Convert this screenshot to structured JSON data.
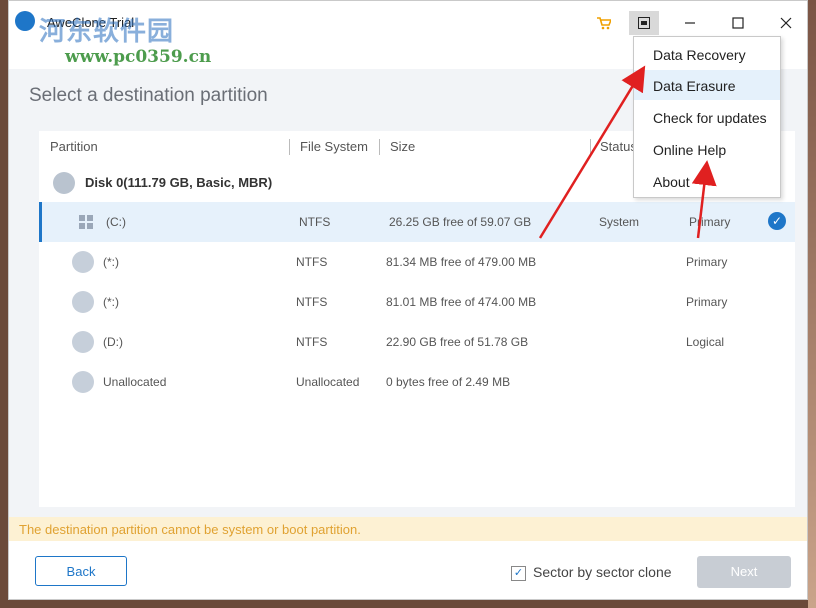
{
  "window": {
    "title": "AweClone Trial",
    "watermark_cn": "河东软件园",
    "watermark_url": "www.pc0359.cn"
  },
  "titlebar": {
    "cart_icon": "cart-icon",
    "menu_icon": "menu-icon",
    "minimize_icon": "minimize-icon",
    "maximize_icon": "maximize-icon",
    "close_icon": "close-icon"
  },
  "page": {
    "heading": "Select a destination partition"
  },
  "table": {
    "columns": [
      "Partition",
      "File System",
      "Size",
      "Status"
    ],
    "disk": {
      "label": "Disk 0(111.79 GB, Basic, MBR)"
    },
    "rows": [
      {
        "name": "(C:)",
        "fs": "NTFS",
        "size": "26.25 GB free of 59.07 GB",
        "status": "System",
        "type": "Primary",
        "selected": true
      },
      {
        "name": "(*:)",
        "fs": "NTFS",
        "size": "81.34 MB free of 479.00 MB",
        "status": "",
        "type": "Primary"
      },
      {
        "name": "(*:)",
        "fs": "NTFS",
        "size": "81.01 MB free of 474.00 MB",
        "status": "",
        "type": "Primary"
      },
      {
        "name": "(D:)",
        "fs": "NTFS",
        "size": "22.90 GB free of 51.78 GB",
        "status": "",
        "type": "Logical"
      },
      {
        "name": "Unallocated",
        "fs": "Unallocated",
        "size": "0 bytes free of 2.49 MB",
        "status": "",
        "type": ""
      }
    ]
  },
  "warning": "The destination partition cannot be system or boot partition.",
  "footer": {
    "back_label": "Back",
    "sector_label": "Sector by sector clone",
    "sector_checked": true,
    "next_label": "Next"
  },
  "menu": {
    "items": [
      "Data Recovery",
      "Data Erasure",
      "Check for updates",
      "Online Help",
      "About"
    ]
  },
  "colors": {
    "accent": "#1e76c8",
    "warning_text": "#e0a232",
    "warning_bg": "#fdf1d3",
    "annotation_arrow": "#e02020"
  }
}
